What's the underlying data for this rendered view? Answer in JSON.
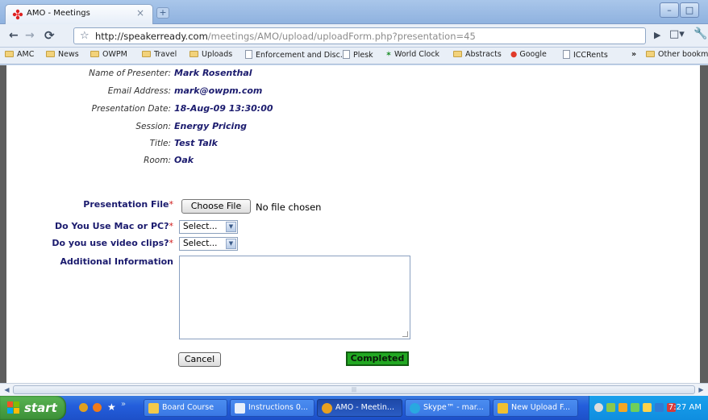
{
  "browser": {
    "tab_title": "AMO - Meetings",
    "tab_close": "×",
    "new_tab": "+",
    "url_host": "http://speakerready.com",
    "url_path": "/meetings/AMO/upload/uploadForm.php?presentation=45",
    "win_min": "–",
    "win_max": "□",
    "win_close": "×"
  },
  "bookmarks": {
    "items": [
      "AMC",
      "News",
      "OWPM",
      "Travel",
      "Uploads",
      "Enforcement and Disc...",
      "Plesk",
      "World Clock",
      "Abstracts",
      "Google",
      "ICCRents"
    ],
    "overflow": "»",
    "other": "Other bookmarks"
  },
  "info": {
    "presenter_label": "Name of Presenter:",
    "presenter": "Mark Rosenthal",
    "email_label": "Email Address:",
    "email": "mark@owpm.com",
    "date_label": "Presentation Date:",
    "date": "18-Aug-09 13:30:00",
    "session_label": "Session:",
    "session": "Energy Pricing",
    "title_label": "Title:",
    "title": "Test Talk",
    "room_label": "Room:",
    "room": "Oak"
  },
  "form": {
    "file_label": "Presentation File",
    "choose_file": "Choose File",
    "no_file": "No file chosen",
    "macpc_label": "Do You Use Mac or PC?",
    "macpc_value": "Select...",
    "video_label": "Do you use video clips?",
    "video_value": "Select...",
    "additional_label": "Additional Information",
    "required_mark": "*",
    "cancel": "Cancel",
    "completed": "Completed"
  },
  "taskbar": {
    "start": "start",
    "tasks": [
      "Board Course",
      "Instructions 0...",
      "AMO - Meetin...",
      "Skype™ - mar...",
      "New Upload F..."
    ],
    "clock": "7:27 AM"
  },
  "colors": {
    "label_blue": "#1b1b6e",
    "required_red": "#d01919",
    "completed_green": "#22a822"
  }
}
